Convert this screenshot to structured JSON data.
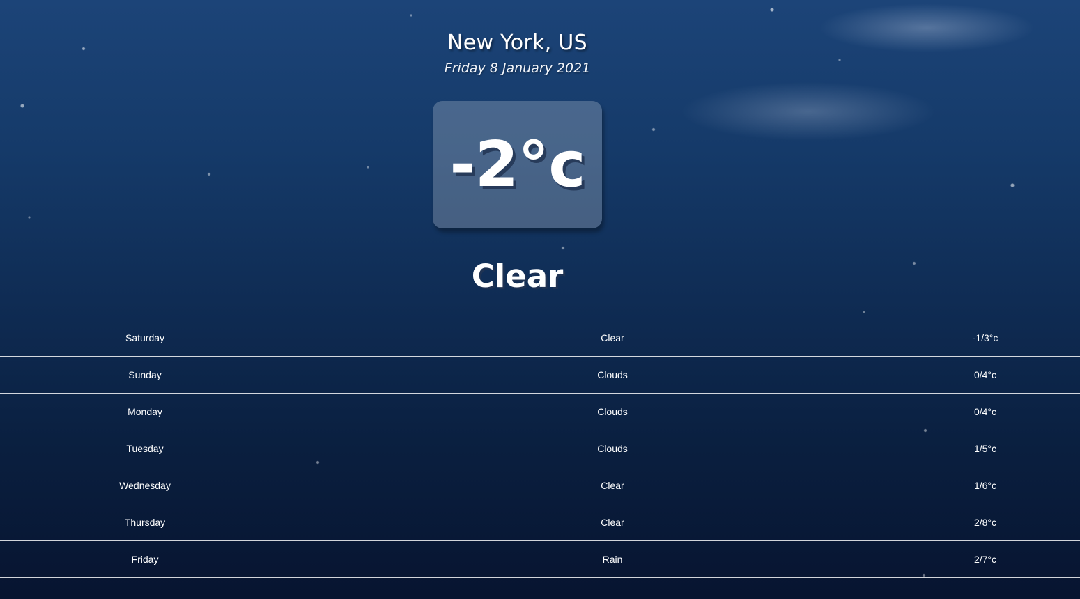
{
  "location": "New York, US",
  "date": "Friday 8 January 2021",
  "current": {
    "temperature": "-2°c",
    "condition": "Clear"
  },
  "forecast": [
    {
      "day": "Saturday",
      "condition": "Clear",
      "range": "-1/3°c"
    },
    {
      "day": "Sunday",
      "condition": "Clouds",
      "range": "0/4°c"
    },
    {
      "day": "Monday",
      "condition": "Clouds",
      "range": "0/4°c"
    },
    {
      "day": "Tuesday",
      "condition": "Clouds",
      "range": "1/5°c"
    },
    {
      "day": "Wednesday",
      "condition": "Clear",
      "range": "1/6°c"
    },
    {
      "day": "Thursday",
      "condition": "Clear",
      "range": "2/8°c"
    },
    {
      "day": "Friday",
      "condition": "Rain",
      "range": "2/7°c"
    }
  ]
}
